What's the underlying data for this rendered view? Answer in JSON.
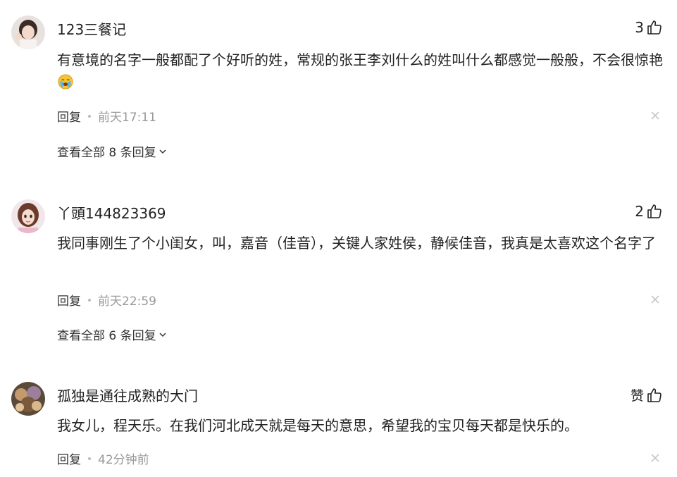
{
  "comments": [
    {
      "username": "123三餐记",
      "like_count": "3",
      "text": "有意境的名字一般都配了个好听的姓，常规的张王李刘什么的姓叫什么都感觉一般般，不会很惊艳",
      "emoji_icon": "crying-face-icon",
      "reply_label": "回复",
      "time": "前天17:11",
      "view_all_label": "查看全部 8 条回复"
    },
    {
      "username": "丫頭144823369",
      "like_count": "2",
      "text": "我同事刚生了个小闺女，叫，嘉音（佳音），关键人家姓侯，静候佳音，我真是太喜欢这个名字了",
      "reply_label": "回复",
      "time": "前天22:59",
      "view_all_label": "查看全部 6 条回复"
    },
    {
      "username": "孤独是通往成熟的大门",
      "like_count": "赞",
      "text": "我女儿，程天乐。在我们河北成天就是每天的意思，希望我的宝贝每天都是快乐的。",
      "reply_label": "回复",
      "time": "42分钟前"
    }
  ],
  "icons": {
    "like": "thumbs-up-icon",
    "close": "close-icon",
    "expand": "chevron-down-icon"
  }
}
